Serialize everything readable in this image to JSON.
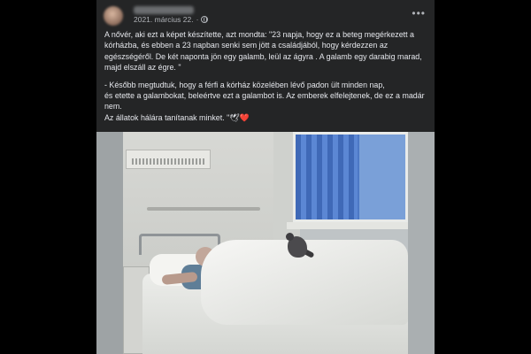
{
  "post": {
    "author": "",
    "date": "2021. március 22.",
    "separator": "·",
    "audience_icon": "globe-icon",
    "more_icon": "more-options-icon",
    "more_label": "•••",
    "paragraph1": "A nővér, aki ezt a képet készítette, azt mondta: \"23 napja, hogy ez a beteg megérkezett a kórházba, és ebben a 23 napban senki sem jött a családjából, hogy kérdezzen az egészségéről. De két naponta jön egy galamb,  leül az ágyra . A galamb egy darabig marad, majd elszáll az égre. \"",
    "paragraph2_line1": " - Később megtudtuk, hogy a férfi a kórház közelében lévő padon ült minden nap,",
    "paragraph2_line2": "és etette a galambokat, beleértve ezt a galambot  is.  Az emberek elfelejtenek, de ez a madár nem.",
    "paragraph2_line3": " Az állatok hálára tanítanak minket. \"",
    "emoji": "🕊❤️",
    "image_description_icon": "hospital-photo"
  },
  "colors": {
    "page_background": "#000000",
    "card_background": "#242526",
    "text_primary": "#e4e6eb",
    "text_secondary": "#b0b3b8"
  }
}
